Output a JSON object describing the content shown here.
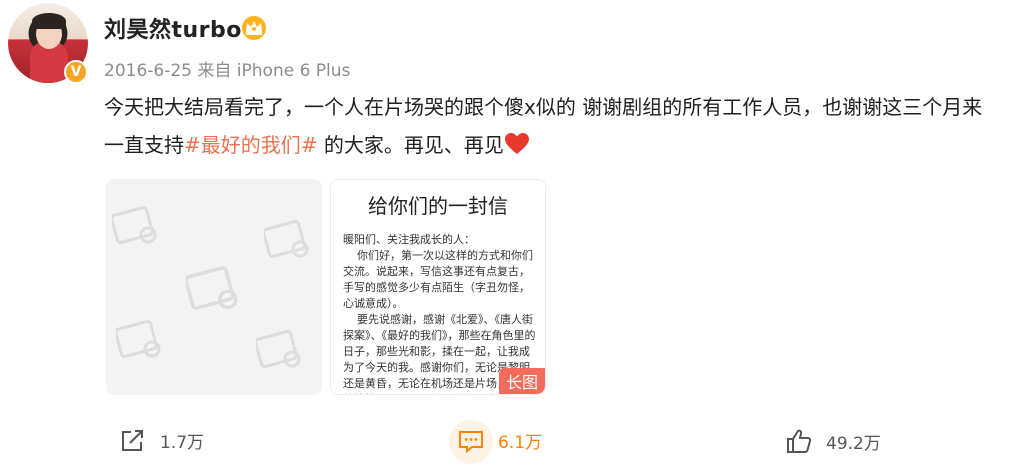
{
  "post": {
    "username": "刘昊然turbo",
    "date": "2016-6-25",
    "source": "来自 iPhone 6 Plus",
    "text_before": "今天把大结局看完了，一个人在片场哭的跟个傻x似的 谢谢剧组的所有工作人员，也谢谢这三个月来一直支持",
    "hashtag": "#最好的我们#",
    "text_after": " 的大家。再见、再见",
    "verified_badge": "V"
  },
  "images": {
    "letter_title": "给你们的一封信",
    "letter_body": "暖阳们、关注我成长的人：\n    你们好，第一次以这样的方式和你们交流。说起来，写信这事还有点复古，手写的感觉多少有点陌生（字丑勿怪，心诚意成）。\n    要先说感谢，感谢《北爱》、《唐人街探案》、《最好的我们》，那些在角色里的日子，那些光和影，揉在一起，让我成为了今天的我。感谢你们，无论是黎明还是黄昏，无论在机场还是片场，你们的热情……入、喂转、字句，直的让我好……",
    "long_image_badge": "长图"
  },
  "actions": {
    "repost_count": "1.7万",
    "comment_count": "6.1万",
    "like_count": "49.2万"
  },
  "colors": {
    "accent": "#ff8200",
    "hashtag": "#eb7350",
    "meta": "#8c8c8c",
    "heart": "#e8392f"
  }
}
